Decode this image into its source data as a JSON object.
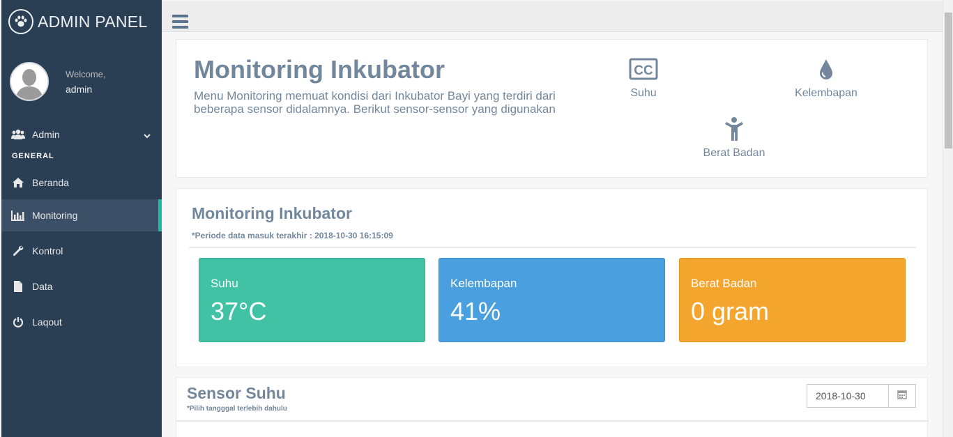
{
  "brand": {
    "title": "ADMIN PANEL",
    "icon": "paw-icon"
  },
  "profile": {
    "welcome": "Welcome,",
    "name": "admin"
  },
  "sidebar": {
    "user_menu": {
      "label": "Admin",
      "icon": "users-icon"
    },
    "section": "GENERAL",
    "items": [
      {
        "label": "Beranda",
        "icon": "home-icon"
      },
      {
        "label": "Monitoring",
        "icon": "bar-chart-icon",
        "active": true
      },
      {
        "label": "Kontrol",
        "icon": "wrench-icon"
      },
      {
        "label": "Data",
        "icon": "file-icon"
      },
      {
        "label": "Laqout",
        "icon": "power-icon"
      }
    ]
  },
  "intro": {
    "title": "Monitoring Inkubator",
    "description": "Menu Monitoring memuat kondisi dari Inkubator Bayi yang terdiri dari beberapa sensor didalamnya. Berikut sensor-sensor yang digunakan",
    "features": [
      {
        "label": "Suhu",
        "icon": "cc-icon"
      },
      {
        "label": "Kelembapan",
        "icon": "droplet-icon"
      },
      {
        "label": "Berat Badan",
        "icon": "child-icon"
      }
    ]
  },
  "monitoring": {
    "title": "Monitoring Inkubator",
    "period": "*Periode data masuk terakhir : 2018-10-30 16:15:09",
    "tiles": [
      {
        "label": "Suhu",
        "value": "37°C",
        "color": "#41c2a5"
      },
      {
        "label": "Kelembapan",
        "value": "41%",
        "color": "#4aa0de"
      },
      {
        "label": "Berat Badan",
        "value": "0 gram",
        "color": "#f4a52d"
      }
    ]
  },
  "sensor": {
    "title": "Sensor Suhu",
    "hint": "*Pilih tangggal terlebih dahulu",
    "date_value": "2018-10-30",
    "calendar_icon": "calendar-icon"
  },
  "colors": {
    "sidebar": "#2a3f54",
    "accent": "#1abb9c",
    "text": "#73879c"
  }
}
